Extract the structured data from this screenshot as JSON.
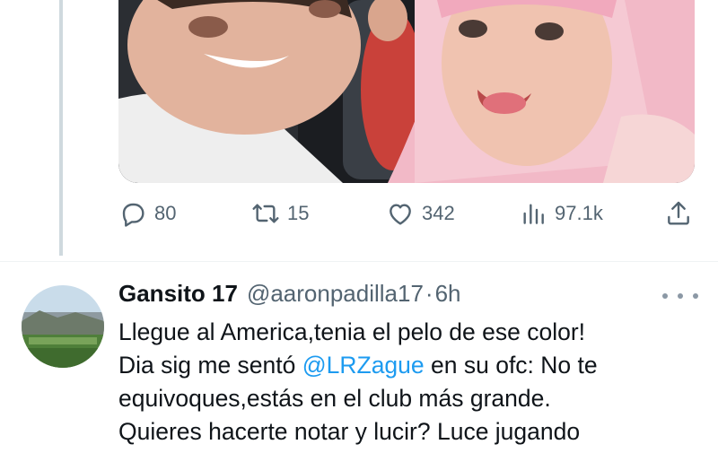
{
  "media": {
    "alt": "photo"
  },
  "parent_actions": {
    "replies": "80",
    "retweets": "15",
    "likes": "342",
    "views": "97.1k"
  },
  "tweet": {
    "display_name": "Gansito 17",
    "handle": "@aaronpadilla17",
    "separator": "·",
    "time": "6h",
    "text_part1": "Llegue al America,tenia el pelo de ese color!\nDia sig me sentó ",
    "mention": "@LRZague",
    "text_part2": " en su ofc: No te\nequivoques,estás en el club más grande.\nQuieres hacerte notar y lucir? Luce jugando"
  },
  "icons": {
    "reply": "reply-icon",
    "retweet": "retweet-icon",
    "like": "heart-icon",
    "views": "views-icon",
    "share": "share-icon",
    "more": "more-icon"
  },
  "colors": {
    "accent": "#1d9bf0",
    "muted": "#536471",
    "text": "#0f1419"
  }
}
